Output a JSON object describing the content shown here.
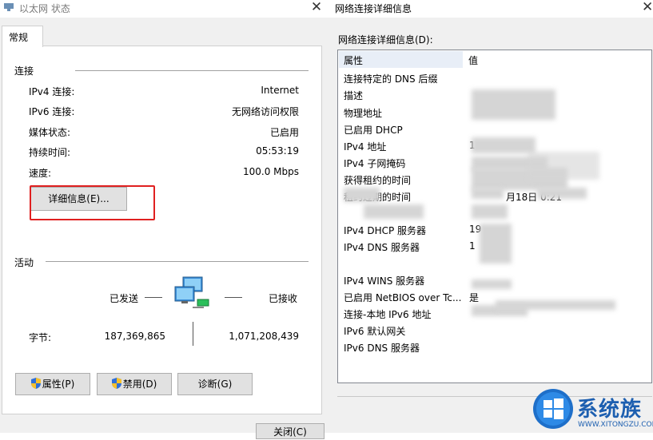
{
  "left_window": {
    "title": "以太网 状态",
    "close_glyph": "✕",
    "tab": "常规",
    "connection": {
      "heading": "连接",
      "rows": [
        {
          "label": "IPv4 连接:",
          "value": "Internet"
        },
        {
          "label": "IPv6 连接:",
          "value": "无网络访问权限"
        },
        {
          "label": "媒体状态:",
          "value": "已启用"
        },
        {
          "label": "持续时间:",
          "value": "05:53:19"
        },
        {
          "label": "速度:",
          "value": "100.0 Mbps"
        }
      ],
      "details_button": "详细信息(E)..."
    },
    "activity": {
      "heading": "活动",
      "sent_label": "已发送",
      "received_label": "已接收",
      "bytes_label": "字节:",
      "bytes_sent": "187,369,865",
      "bytes_received": "1,071,208,439"
    },
    "buttons": {
      "properties": "属性(P)",
      "disable": "禁用(D)",
      "diagnose": "诊断(G)",
      "close": "关闭(C)"
    }
  },
  "right_window": {
    "title": "网络连接详细信息",
    "close_glyph": "✕",
    "list_label": "网络连接详细信息(D):",
    "columns": {
      "property": "属性",
      "value": "值"
    },
    "rows": [
      {
        "property": "连接特定的 DNS 后缀",
        "value": ""
      },
      {
        "property": "描述",
        "value": ""
      },
      {
        "property": "物理地址",
        "value": ""
      },
      {
        "property": "已启用 DHCP",
        "value": ""
      },
      {
        "property": "IPv4 地址",
        "value": "1"
      },
      {
        "property": "IPv4 子网掩码",
        "value": ""
      },
      {
        "property": "获得租约的时间",
        "value": ""
      },
      {
        "property": "租约过期的时间",
        "value": "月18日  0:21"
      },
      {
        "property": "",
        "value": ""
      },
      {
        "property": "IPv4 DHCP 服务器",
        "value": "19"
      },
      {
        "property": "IPv4 DNS 服务器",
        "value": "1"
      },
      {
        "property": "",
        "value": ""
      },
      {
        "property": "IPv4 WINS 服务器",
        "value": ""
      },
      {
        "property": "已启用 NetBIOS over Tc...",
        "value": "是"
      },
      {
        "property": "连接-本地 IPv6 地址",
        "value": ""
      },
      {
        "property": "IPv6 默认网关",
        "value": ""
      },
      {
        "property": "IPv6 DNS 服务器",
        "value": ""
      }
    ]
  },
  "watermark": {
    "text": "系统族",
    "url": "WWW.XITONGZU.COM"
  },
  "colors": {
    "highlight": "#e02020",
    "header_bg": "#e8eef7"
  },
  "icons": [
    "ethernet-icon",
    "close-icon",
    "network-computers-icon",
    "shield-icon",
    "windows-logo-icon"
  ]
}
